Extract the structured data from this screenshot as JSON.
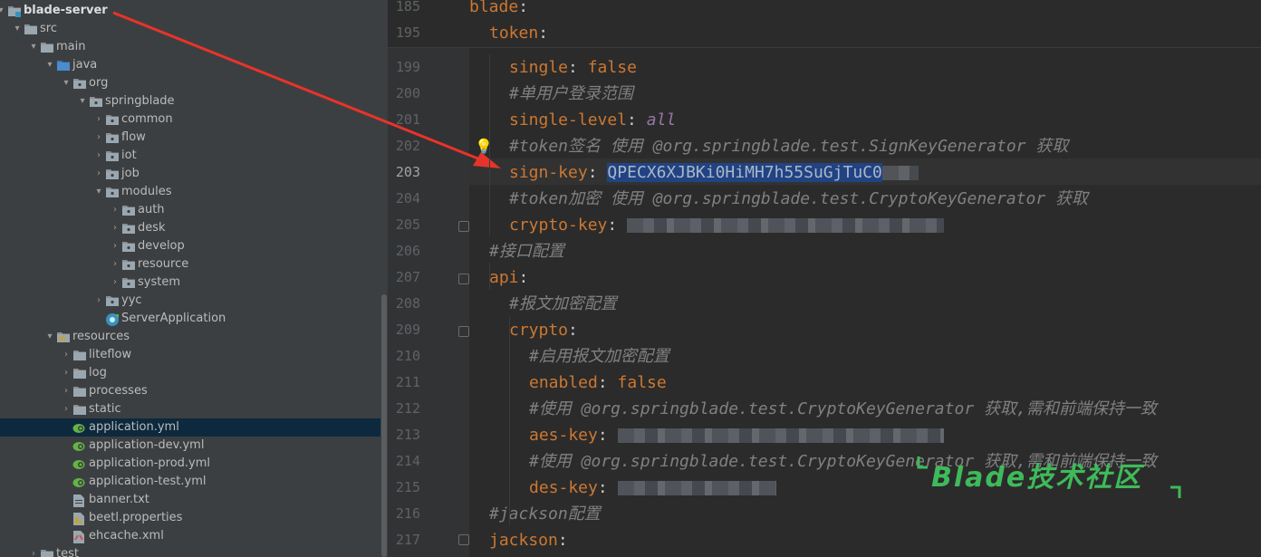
{
  "tree": {
    "items": [
      {
        "label": "blade-server",
        "arrow": "▾",
        "icon": "module-folder-icon",
        "level": 0,
        "bold": true
      },
      {
        "label": "src",
        "arrow": "▾",
        "icon": "folder-icon",
        "level": 1
      },
      {
        "label": "main",
        "arrow": "▾",
        "icon": "folder-icon",
        "level": 2
      },
      {
        "label": "java",
        "arrow": "▾",
        "icon": "source-folder-icon",
        "level": 3
      },
      {
        "label": "org",
        "arrow": "▾",
        "icon": "package-icon",
        "level": 4
      },
      {
        "label": "springblade",
        "arrow": "▾",
        "icon": "package-icon",
        "level": 5
      },
      {
        "label": "common",
        "arrow": "›",
        "icon": "package-icon",
        "level": 6
      },
      {
        "label": "flow",
        "arrow": "›",
        "icon": "package-icon",
        "level": 6
      },
      {
        "label": "iot",
        "arrow": "›",
        "icon": "package-icon",
        "level": 6
      },
      {
        "label": "job",
        "arrow": "›",
        "icon": "package-icon",
        "level": 6
      },
      {
        "label": "modules",
        "arrow": "▾",
        "icon": "package-icon",
        "level": 6
      },
      {
        "label": "auth",
        "arrow": "›",
        "icon": "package-icon",
        "level": 7
      },
      {
        "label": "desk",
        "arrow": "›",
        "icon": "package-icon",
        "level": 7
      },
      {
        "label": "develop",
        "arrow": "›",
        "icon": "package-icon",
        "level": 7
      },
      {
        "label": "resource",
        "arrow": "›",
        "icon": "package-icon",
        "level": 7
      },
      {
        "label": "system",
        "arrow": "›",
        "icon": "package-icon",
        "level": 7
      },
      {
        "label": "yyc",
        "arrow": "›",
        "icon": "package-icon",
        "level": 6
      },
      {
        "label": "ServerApplication",
        "arrow": "",
        "icon": "spring-boot-class-icon",
        "level": 6
      },
      {
        "label": "resources",
        "arrow": "▾",
        "icon": "resources-folder-icon",
        "level": 3
      },
      {
        "label": "liteflow",
        "arrow": "›",
        "icon": "folder-icon",
        "level": 4
      },
      {
        "label": "log",
        "arrow": "›",
        "icon": "folder-icon",
        "level": 4
      },
      {
        "label": "processes",
        "arrow": "›",
        "icon": "folder-icon",
        "level": 4
      },
      {
        "label": "static",
        "arrow": "›",
        "icon": "folder-icon",
        "level": 4
      },
      {
        "label": "application.yml",
        "arrow": "",
        "icon": "yaml-spring-icon",
        "level": 4,
        "selected": true
      },
      {
        "label": "application-dev.yml",
        "arrow": "",
        "icon": "yaml-spring-icon",
        "level": 4
      },
      {
        "label": "application-prod.yml",
        "arrow": "",
        "icon": "yaml-spring-icon",
        "level": 4
      },
      {
        "label": "application-test.yml",
        "arrow": "",
        "icon": "yaml-spring-icon",
        "level": 4
      },
      {
        "label": "banner.txt",
        "arrow": "",
        "icon": "text-file-icon",
        "level": 4
      },
      {
        "label": "beetl.properties",
        "arrow": "",
        "icon": "properties-file-icon",
        "level": 4
      },
      {
        "label": "ehcache.xml",
        "arrow": "",
        "icon": "xml-file-icon",
        "level": 4
      },
      {
        "label": "test",
        "arrow": "›",
        "icon": "folder-icon",
        "level": 2
      }
    ]
  },
  "editor": {
    "sticky": [
      {
        "num": "185",
        "indent": 0,
        "segs": [
          {
            "t": "k",
            "v": "blade"
          },
          {
            "t": "p",
            "v": ":"
          }
        ]
      },
      {
        "num": "195",
        "indent": 1,
        "segs": [
          {
            "t": "k",
            "v": "token"
          },
          {
            "t": "p",
            "v": ":"
          }
        ]
      }
    ],
    "lines": [
      {
        "num": "199",
        "indent": 2,
        "segs": [
          {
            "t": "k",
            "v": "single"
          },
          {
            "t": "p",
            "v": ": "
          },
          {
            "t": "b",
            "v": "false"
          }
        ]
      },
      {
        "num": "200",
        "indent": 2,
        "segs": [
          {
            "t": "c",
            "v": "#单用户登录范围"
          }
        ]
      },
      {
        "num": "201",
        "indent": 2,
        "segs": [
          {
            "t": "k",
            "v": "single-level"
          },
          {
            "t": "p",
            "v": ": "
          },
          {
            "t": "f",
            "v": "all"
          }
        ]
      },
      {
        "num": "202",
        "indent": 2,
        "segs": [
          {
            "t": "c",
            "v": "#token签名 使用 @org.springblade.test.SignKeyGenerator 获取"
          }
        ]
      },
      {
        "num": "203",
        "indent": 2,
        "current": true,
        "segs": [
          {
            "t": "k",
            "v": "sign-key"
          },
          {
            "t": "p",
            "v": ": "
          },
          {
            "t": "s",
            "v": "QPECX6XJBKi0HiMH7h55SuGjTuC0"
          },
          {
            "t": "x",
            "v": "redacted",
            "w": 40
          }
        ]
      },
      {
        "num": "204",
        "indent": 2,
        "segs": [
          {
            "t": "c",
            "v": "#token加密 使用 @org.springblade.test.CryptoKeyGenerator 获取"
          }
        ]
      },
      {
        "num": "205",
        "indent": 2,
        "segs": [
          {
            "t": "k",
            "v": "crypto-key"
          },
          {
            "t": "p",
            "v": ": "
          },
          {
            "t": "x",
            "v": "redacted",
            "w": 350
          }
        ]
      },
      {
        "num": "206",
        "indent": 1,
        "segs": [
          {
            "t": "c",
            "v": "#接口配置"
          }
        ]
      },
      {
        "num": "207",
        "indent": 1,
        "segs": [
          {
            "t": "k",
            "v": "api"
          },
          {
            "t": "p",
            "v": ":"
          }
        ]
      },
      {
        "num": "208",
        "indent": 2,
        "segs": [
          {
            "t": "c",
            "v": "#报文加密配置"
          }
        ]
      },
      {
        "num": "209",
        "indent": 2,
        "segs": [
          {
            "t": "k",
            "v": "crypto"
          },
          {
            "t": "p",
            "v": ":"
          }
        ]
      },
      {
        "num": "210",
        "indent": 3,
        "segs": [
          {
            "t": "c",
            "v": "#启用报文加密配置"
          }
        ]
      },
      {
        "num": "211",
        "indent": 3,
        "segs": [
          {
            "t": "k",
            "v": "enabled"
          },
          {
            "t": "p",
            "v": ": "
          },
          {
            "t": "b",
            "v": "false"
          }
        ]
      },
      {
        "num": "212",
        "indent": 3,
        "segs": [
          {
            "t": "c",
            "v": "#使用 @org.springblade.test.CryptoKeyGenerator 获取,需和前端保持一致"
          }
        ]
      },
      {
        "num": "213",
        "indent": 3,
        "segs": [
          {
            "t": "k",
            "v": "aes-key"
          },
          {
            "t": "p",
            "v": ": "
          },
          {
            "t": "x",
            "v": "redacted",
            "w": 360
          }
        ]
      },
      {
        "num": "214",
        "indent": 3,
        "segs": [
          {
            "t": "c",
            "v": "#使用 @org.springblade.test.CryptoKeyGenerator 获取,需和前端保持一致"
          }
        ]
      },
      {
        "num": "215",
        "indent": 3,
        "segs": [
          {
            "t": "k",
            "v": "des-key"
          },
          {
            "t": "p",
            "v": ": "
          },
          {
            "t": "x",
            "v": "redacted",
            "w": 175
          }
        ]
      },
      {
        "num": "216",
        "indent": 1,
        "segs": [
          {
            "t": "c",
            "v": "#jackson配置"
          }
        ]
      },
      {
        "num": "217",
        "indent": 1,
        "segs": [
          {
            "t": "k",
            "v": "jackson"
          },
          {
            "t": "p",
            "v": ":"
          }
        ]
      }
    ]
  },
  "watermark": {
    "text": "Blade技术社区"
  },
  "colors": {
    "keyword": "#cc7832",
    "comment": "#808080",
    "selection": "#214283",
    "arrow": "#e8332a",
    "watermark": "#3fba5a"
  }
}
